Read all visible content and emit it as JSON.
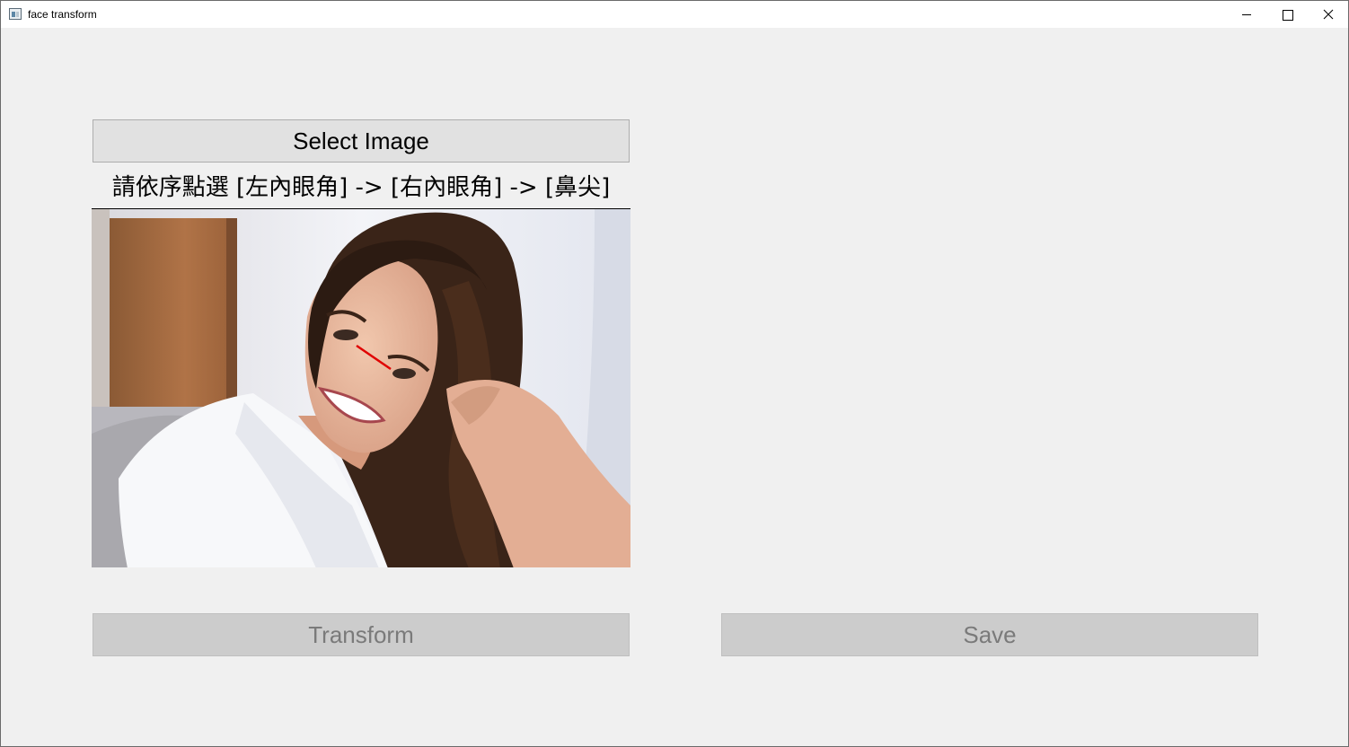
{
  "window": {
    "title": "face transform",
    "minimize_icon": "minimize-icon",
    "maximize_icon": "maximize-icon",
    "close_icon": "close-icon"
  },
  "buttons": {
    "select_image": "Select Image",
    "transform": "Transform",
    "save": "Save"
  },
  "instruction": "請依序點選 [左內眼角] -> [右內眼角] -> [鼻尖]",
  "canvas": {
    "content": "photo-of-smiling-woman",
    "annotation_line_color": "#e00000"
  },
  "colors": {
    "window_bg": "#f0f0f0",
    "button_bg": "#e1e1e1",
    "disabled_button_bg": "#cccccc",
    "disabled_text": "#7a7a7a"
  }
}
